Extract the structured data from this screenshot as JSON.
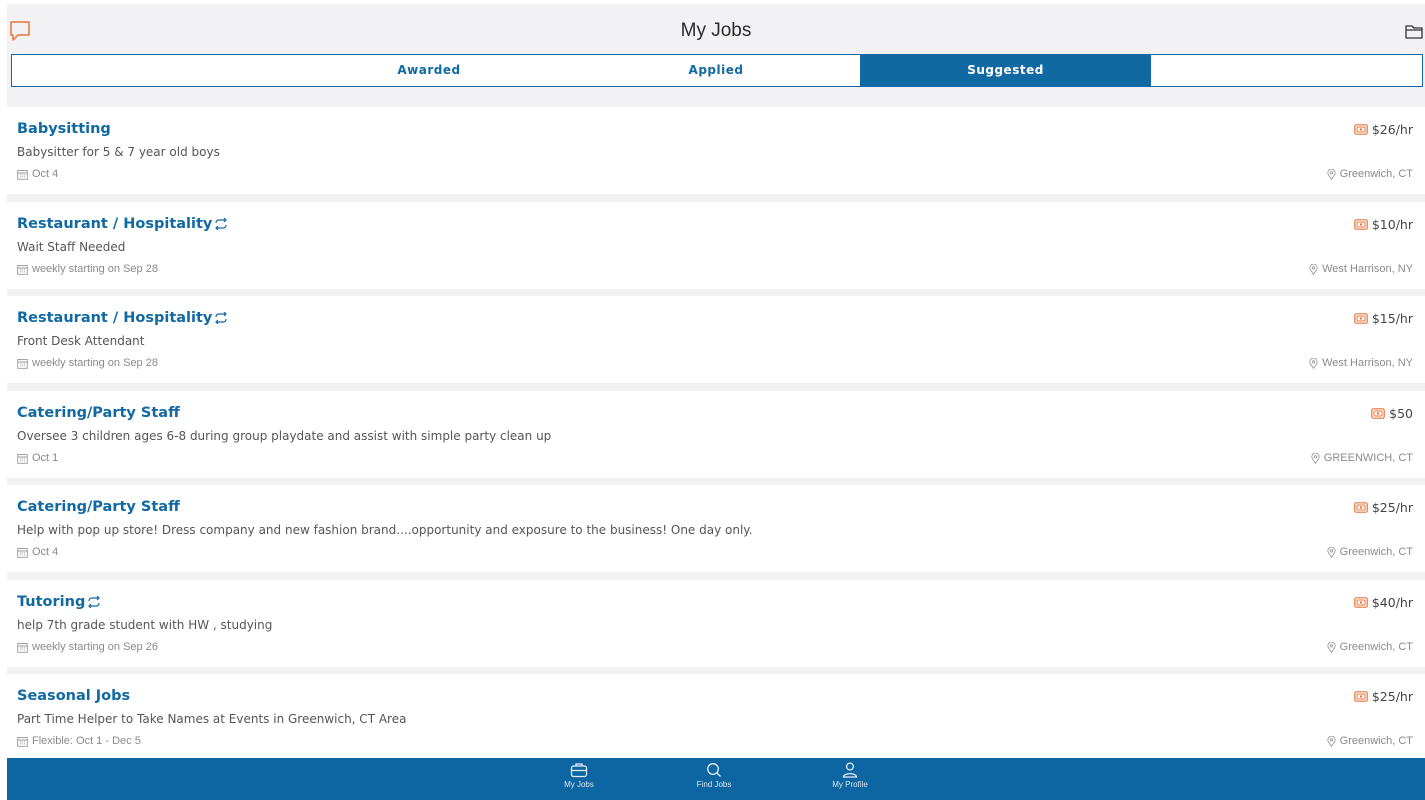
{
  "header": {
    "title": "My Jobs",
    "left_icon": "chat-bubble-icon",
    "right_icon": "folder-icon"
  },
  "tabs": [
    {
      "label": "Awarded",
      "active": false
    },
    {
      "label": "Applied",
      "active": false
    },
    {
      "label": "Suggested",
      "active": true
    },
    {
      "label": "",
      "active": false
    }
  ],
  "jobs": [
    {
      "title": "Babysitting",
      "recurring": false,
      "description": "Babysitter for 5 & 7 year old boys",
      "date": "Oct 4",
      "pay": "$26/hr",
      "location": "Greenwich, CT"
    },
    {
      "title": "Restaurant / Hospitality",
      "recurring": true,
      "description": "Wait Staff Needed",
      "date": "weekly starting on Sep 28",
      "pay": "$10/hr",
      "location": "West Harrison, NY"
    },
    {
      "title": "Restaurant / Hospitality",
      "recurring": true,
      "description": "Front Desk Attendant",
      "date": "weekly starting on Sep 28",
      "pay": "$15/hr",
      "location": "West Harrison, NY"
    },
    {
      "title": "Catering/Party Staff",
      "recurring": false,
      "description": "Oversee 3 children ages 6-8 during group playdate and assist with simple party clean up",
      "date": "Oct 1",
      "pay": "$50",
      "location": "GREENWICH, CT"
    },
    {
      "title": "Catering/Party Staff",
      "recurring": false,
      "description": "Help with pop up store! Dress company and new fashion brand....opportunity and exposure to the business! One day only.",
      "date": "Oct 4",
      "pay": "$25/hr",
      "location": "Greenwich, CT"
    },
    {
      "title": "Tutoring",
      "recurring": true,
      "description": "help 7th grade student with HW , studying",
      "date": "weekly starting on Sep 26",
      "pay": "$40/hr",
      "location": "Greenwich, CT"
    },
    {
      "title": "Seasonal Jobs",
      "recurring": false,
      "description": "Part Time Helper to Take Names at Events in Greenwich, CT Area",
      "date": "Flexible: Oct 1 - Dec 5",
      "pay": "$25/hr",
      "location": "Greenwich, CT"
    }
  ],
  "bottom_nav": [
    {
      "label": "My Jobs",
      "icon": "briefcase-icon"
    },
    {
      "label": "Find Jobs",
      "icon": "search-icon"
    },
    {
      "label": "My Profile",
      "icon": "person-icon"
    }
  ],
  "colors": {
    "brand_blue": "#1169a3",
    "accent_orange": "#e8743b",
    "nav_bg": "#0d65a2"
  }
}
